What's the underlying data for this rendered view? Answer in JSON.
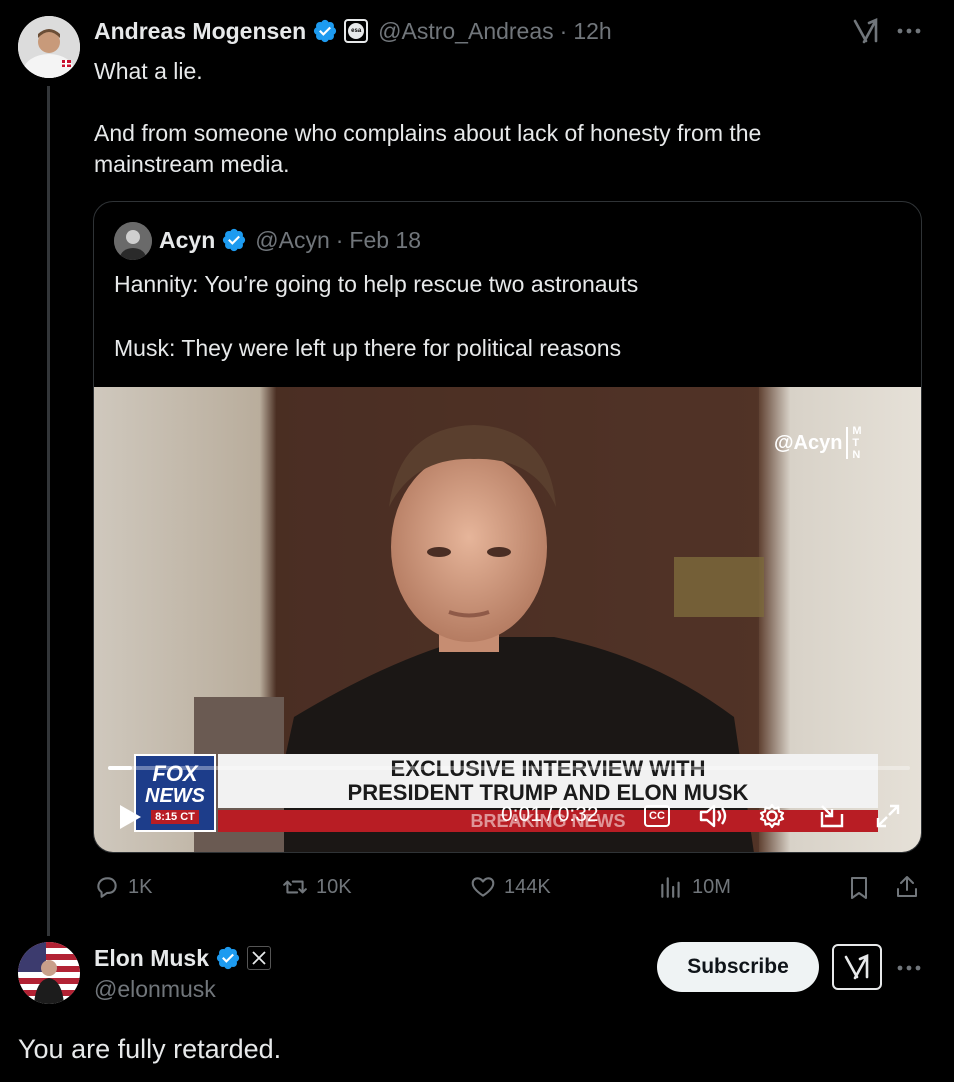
{
  "tweet": {
    "author_name": "Andreas Mogensen",
    "author_handle": "@Astro_Andreas",
    "sep": "·",
    "time": "12h",
    "org_badge": "esa",
    "text_line1": "What a lie.",
    "text_line2": "And from someone who complains about lack of honesty from the",
    "text_line3": "mainstream media."
  },
  "quote": {
    "author_name": "Acyn",
    "author_handle": "@Acyn",
    "sep": "·",
    "date": "Feb 18",
    "text_line1": "Hannity: You’re going to help rescue two astronauts",
    "text_line2": "Musk: They were left up there for political reasons"
  },
  "video": {
    "watermark": "@Acyn",
    "watermark_logo": [
      "M",
      "T",
      "N"
    ],
    "chyron_line1": "EXCLUSIVE INTERVIEW WITH",
    "chyron_line2": "PRESIDENT TRUMP AND ELON MUSK",
    "ticker_word": "BREAKING NEWS",
    "network_line1": "FOX",
    "network_line2": "NEWS",
    "network_time": "8:15 CT",
    "time_current": "0:01",
    "time_sep": "/",
    "time_total": "0:32",
    "cc_label": "CC",
    "progress": 0.03
  },
  "actions": {
    "replies": "1K",
    "reposts": "10K",
    "likes": "144K",
    "views": "10M"
  },
  "reply": {
    "author_name": "Elon Musk",
    "author_handle": "@elonmusk",
    "subscribe_label": "Subscribe",
    "text": "You are fully retarded."
  },
  "colors": {
    "verified_blue": "#1d9bf0",
    "muted": "#71767b",
    "background": "#000000"
  },
  "icons": [
    "grok-icon",
    "more-icon",
    "verified-icon",
    "reply-icon",
    "repost-icon",
    "like-icon",
    "views-icon",
    "bookmark-icon",
    "share-icon",
    "play-icon",
    "cc-icon",
    "volume-icon",
    "settings-icon",
    "pip-icon",
    "fullscreen-icon",
    "x-logo-icon"
  ]
}
